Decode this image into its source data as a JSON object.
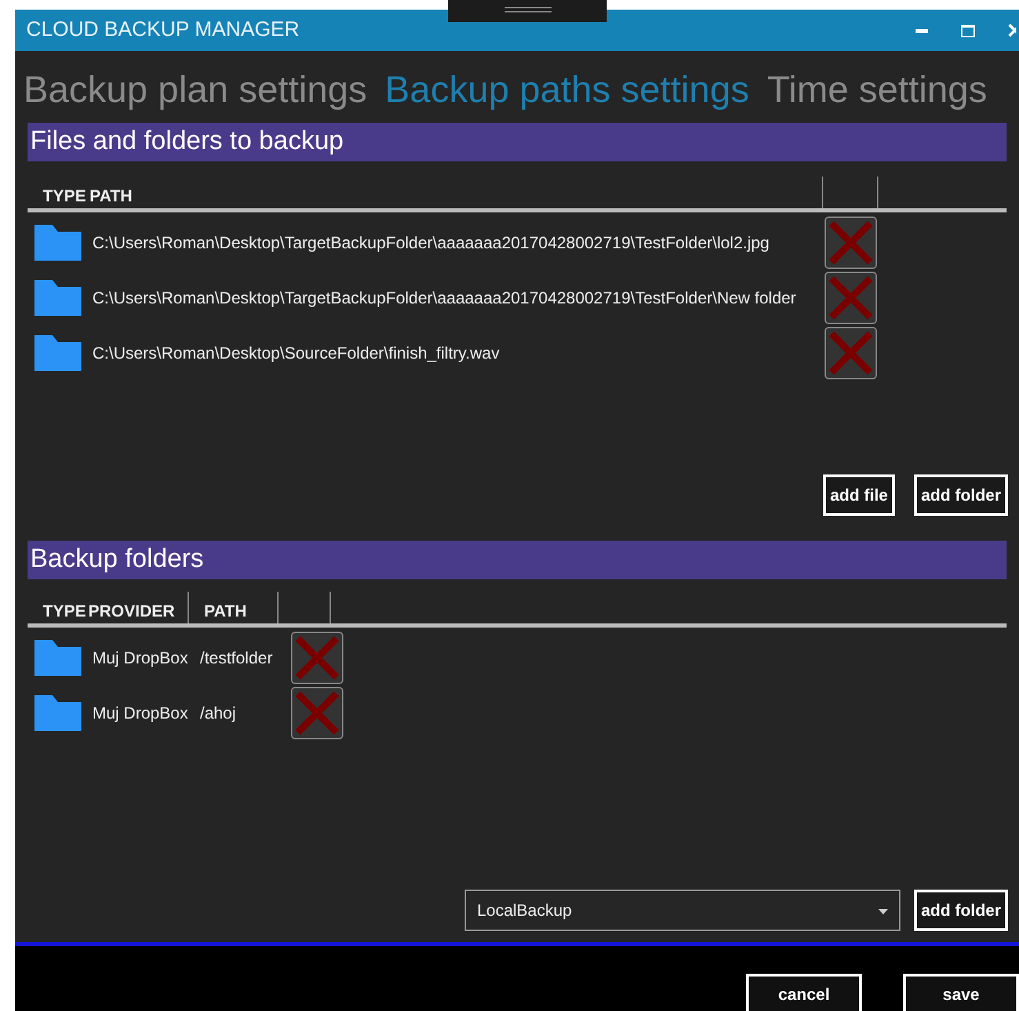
{
  "window": {
    "title": "CLOUD BACKUP MANAGER"
  },
  "tabs": [
    {
      "label": "Backup plan settings",
      "selected": false
    },
    {
      "label": "Backup paths settings",
      "selected": true
    },
    {
      "label": "Time settings",
      "selected": false
    }
  ],
  "files_section": {
    "title": "Files and folders to backup",
    "columns": [
      "TYPE",
      "PATH"
    ],
    "rows": [
      {
        "path": "C:\\Users\\Roman\\Desktop\\TargetBackupFolder\\aaaaaaa20170428002719\\TestFolder\\lol2.jpg"
      },
      {
        "path": "C:\\Users\\Roman\\Desktop\\TargetBackupFolder\\aaaaaaa20170428002719\\TestFolder\\New folder"
      },
      {
        "path": "C:\\Users\\Roman\\Desktop\\SourceFolder\\finish_filtry.wav"
      }
    ],
    "buttons": [
      "add file",
      "add folder"
    ]
  },
  "backup_folders": {
    "title": "Backup folders",
    "columns": [
      "TYPE",
      "PROVIDER",
      "PATH"
    ],
    "rows": [
      {
        "provider": "Muj DropBox",
        "path": "/testfolder"
      },
      {
        "provider": "Muj DropBox",
        "path": "/ahoj"
      }
    ],
    "provider_select": {
      "value": "LocalBackup"
    },
    "button": "add folder"
  },
  "footer_buttons": [
    "cancel",
    "save"
  ]
}
